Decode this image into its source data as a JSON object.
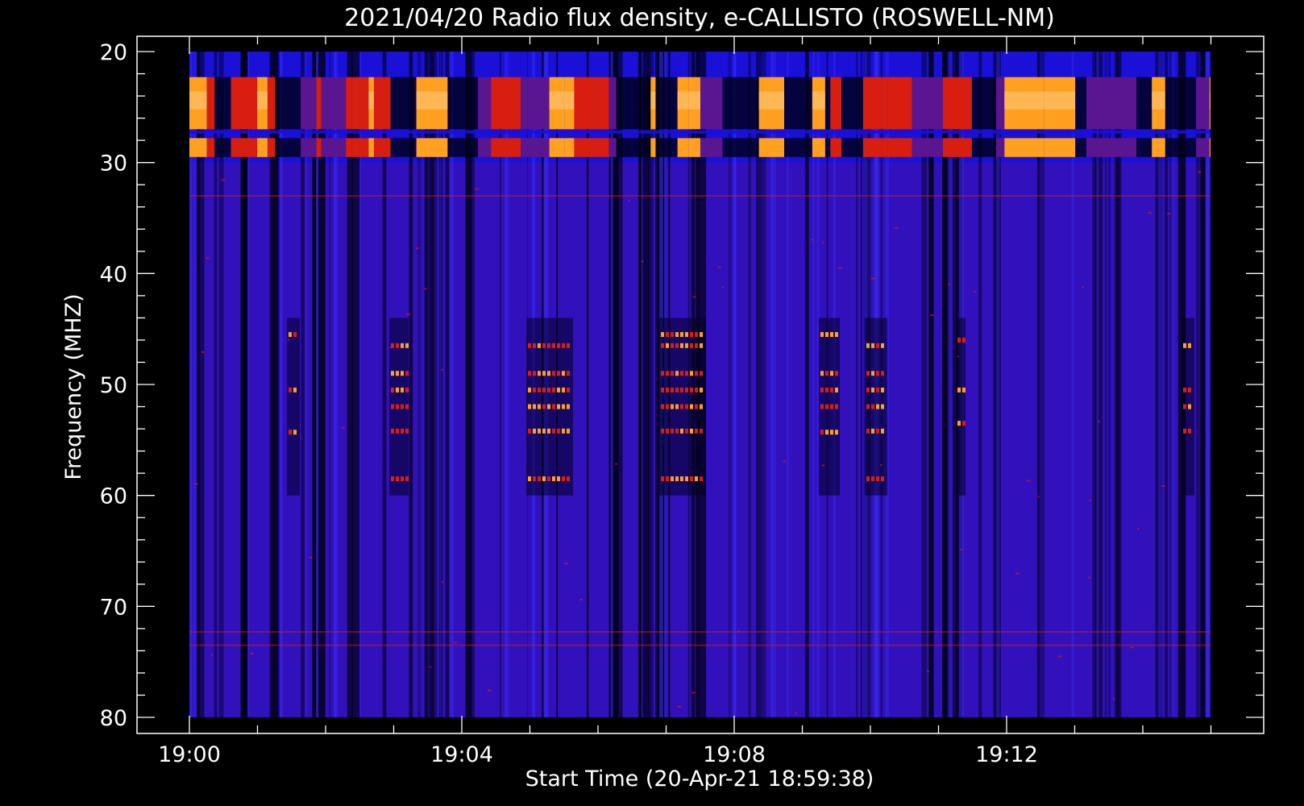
{
  "chart_data": {
    "type": "heatmap",
    "title": "2021/04/20  Radio flux density, e-CALLISTO (ROSWELL-NM)",
    "xlabel": "Start Time (20-Apr-21 18:59:38)",
    "ylabel": "Frequency (MHZ)",
    "xlim": [
      "19:00",
      "19:15"
    ],
    "ylim": [
      20,
      80
    ],
    "y_inverted": true,
    "x_tick_labels": [
      "19:00",
      "19:04",
      "19:08",
      "19:12"
    ],
    "y_tick_labels": [
      "20",
      "30",
      "40",
      "50",
      "60",
      "70",
      "80"
    ],
    "colors": {
      "background": "#000000",
      "low": "#1a10d8",
      "mid": "#5a1690",
      "high": "#d81e10",
      "peak": "#ffa020",
      "axis": "#ffffff"
    }
  }
}
